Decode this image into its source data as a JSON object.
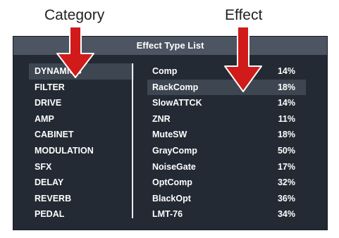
{
  "captions": {
    "category": "Category",
    "effect": "Effect"
  },
  "panel": {
    "title": "Effect Type List"
  },
  "categories": [
    {
      "label": "DYNAMICS",
      "selected": true
    },
    {
      "label": "FILTER"
    },
    {
      "label": "DRIVE"
    },
    {
      "label": "AMP"
    },
    {
      "label": "CABINET"
    },
    {
      "label": "MODULATION"
    },
    {
      "label": "SFX"
    },
    {
      "label": "DELAY"
    },
    {
      "label": "REVERB"
    },
    {
      "label": "PEDAL"
    }
  ],
  "effects": [
    {
      "name": "Comp",
      "value": "14%"
    },
    {
      "name": "RackComp",
      "value": "18%",
      "selected": true
    },
    {
      "name": "SlowATTCK",
      "value": "14%"
    },
    {
      "name": "ZNR",
      "value": "11%"
    },
    {
      "name": "MuteSW",
      "value": "18%"
    },
    {
      "name": "GrayComp",
      "value": "50%"
    },
    {
      "name": "NoiseGate",
      "value": "17%"
    },
    {
      "name": "OptComp",
      "value": "32%"
    },
    {
      "name": "BlackOpt",
      "value": "36%"
    },
    {
      "name": "LMT-76",
      "value": "34%"
    }
  ],
  "colors": {
    "arrow": "#d11a1a",
    "panel_bg": "#232a33",
    "title_bar": "#4c5561",
    "selection": "#3d4651"
  },
  "icons": {
    "category_pointer": "down-arrow-icon",
    "effect_pointer": "down-arrow-icon"
  }
}
